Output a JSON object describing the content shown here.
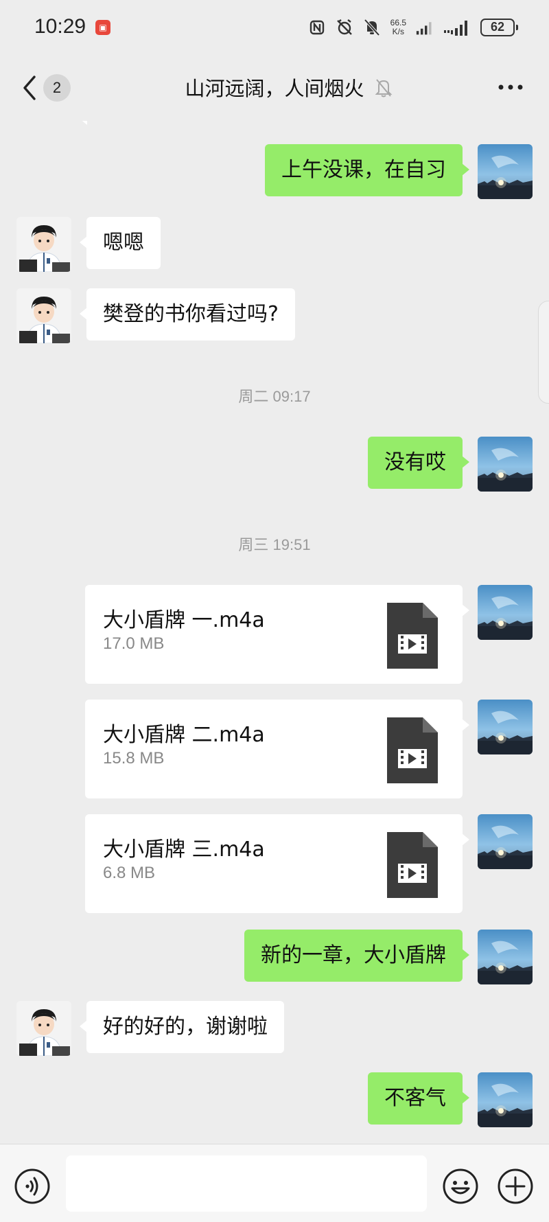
{
  "status_bar": {
    "time": "10:29",
    "net_speed_top": "66.5",
    "net_speed_bottom": "K/s",
    "battery": "62"
  },
  "nav": {
    "unread_count": "2",
    "title": "山河远阔，人间烟火"
  },
  "messages": {
    "m1": "上午没课，在自习",
    "m2": "嗯嗯",
    "m3": "樊登的书你看过吗?",
    "ts1": "周二 09:17",
    "m4": "没有哎",
    "ts2": "周三 19:51",
    "files": [
      {
        "name": "大小盾牌 一.m4a",
        "size": "17.0 MB"
      },
      {
        "name": "大小盾牌 二.m4a",
        "size": "15.8 MB"
      },
      {
        "name": "大小盾牌 三.m4a",
        "size": "6.8 MB"
      }
    ],
    "m5": "新的一章，大小盾牌",
    "m6": "好的好的，谢谢啦",
    "m7": "不客气"
  },
  "colors": {
    "self_bubble": "#95ec69",
    "peer_bubble": "#ffffff",
    "background": "#ededed"
  },
  "icons": {
    "back": "chevron-left-icon",
    "mute": "bell-off-icon",
    "more": "more-dots-icon",
    "voice": "voice-icon",
    "emoji": "emoji-icon",
    "plus": "plus-icon",
    "file": "video-file-icon"
  }
}
